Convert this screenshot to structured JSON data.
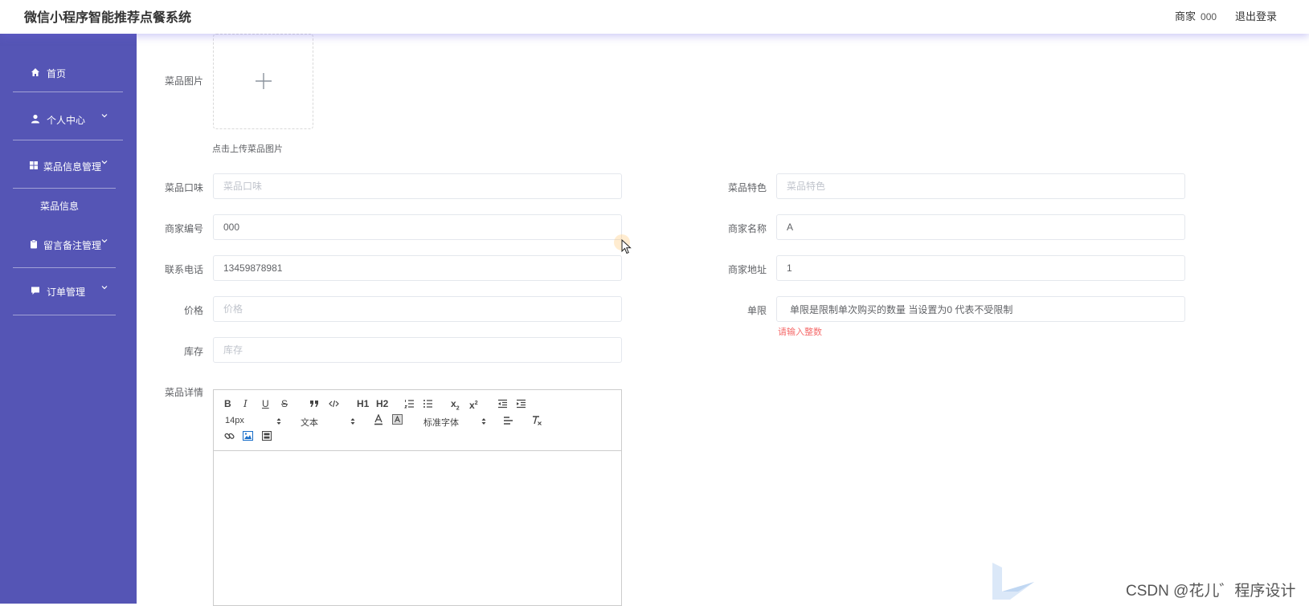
{
  "header": {
    "title": "微信小程序智能推荐点餐系统",
    "user_role": "商家",
    "user_id": "000",
    "logout": "退出登录"
  },
  "sidebar": {
    "items": [
      {
        "label": "首页",
        "icon": "home-icon"
      },
      {
        "label": "个人中心",
        "icon": "user-icon"
      },
      {
        "label": "菜品信息管理",
        "icon": "grid-icon"
      },
      {
        "label": "留言备注管理",
        "icon": "clipboard-icon"
      },
      {
        "label": "订单管理",
        "icon": "message-icon"
      }
    ],
    "sub_items": [
      {
        "label": "菜品信息"
      }
    ]
  },
  "form": {
    "image": {
      "label": "菜品图片",
      "tip": "点击上传菜品图片"
    },
    "taste": {
      "label": "菜品口味",
      "placeholder": "菜品口味",
      "value": ""
    },
    "feature": {
      "label": "菜品特色",
      "placeholder": "菜品特色",
      "value": ""
    },
    "merchant_no": {
      "label": "商家编号",
      "value": "000"
    },
    "merchant_name": {
      "label": "商家名称",
      "value": "A"
    },
    "phone": {
      "label": "联系电话",
      "value": "13459878981"
    },
    "address": {
      "label": "商家地址",
      "value": "1"
    },
    "price": {
      "label": "价格",
      "placeholder": "价格",
      "value": ""
    },
    "limit": {
      "label": "单限",
      "value": "单限是限制单次购买的数量 当设置为0 代表不受限制",
      "error": "请输入整数"
    },
    "stock": {
      "label": "库存",
      "placeholder": "库存",
      "value": ""
    },
    "detail": {
      "label": "菜品详情"
    }
  },
  "editor": {
    "toolbar": {
      "bold": "B",
      "italic": "I",
      "underline": "U",
      "strike": "S",
      "h1": "H1",
      "h2": "H2",
      "sub": "x",
      "sup": "x",
      "font_size": "14px",
      "header_select": "文本",
      "font_family": "标准字体"
    },
    "content": ""
  },
  "watermark": "CSDN @花儿゛程序设计"
}
